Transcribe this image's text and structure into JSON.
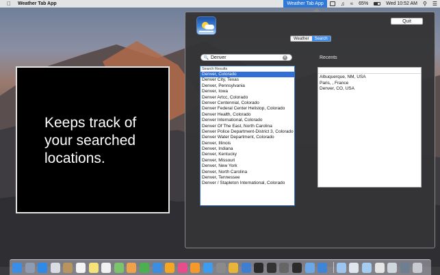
{
  "menubar": {
    "apple_icon": "apple-icon",
    "app_name": "Weather Tab App",
    "status_app": "Weather Tab App",
    "battery": "65%",
    "clock": "Wed 10:52 AM",
    "status_icons": [
      "display-icon",
      "volume-icon",
      "wifi-icon",
      "battery-icon",
      "spotlight-icon",
      "notification-center-icon"
    ]
  },
  "caption": {
    "text": "Keeps track of your searched locations."
  },
  "popover": {
    "quit_label": "Quit",
    "tabs": [
      {
        "label": "Weather",
        "selected": false
      },
      {
        "label": "Search",
        "selected": true
      }
    ],
    "search": {
      "value": "Denver",
      "placeholder": ""
    },
    "results": {
      "header": "Search Results",
      "items": [
        "Denver, Colorado",
        "Denver City, Texas",
        "Denver, Pennsylvania",
        "Denver, Iowa",
        "Denver Artcc, Colorado",
        "Denver Centennial, Colorado",
        "Denver Federal Center Helistop, Colorado",
        "Denver Health, Colorado",
        "Denver International, Colorado",
        "Denver Of The East, North Carolina",
        "Denver Police Department-District 3, Colorado",
        "Denver Water Department, Colorado",
        "Denver, Illinois",
        "Denver, Indiana",
        "Denver, Kentucky",
        "Denver, Missouri",
        "Denver, New York",
        "Denver, North Carolina",
        "Denver, Tennessee",
        "Denver / Stapleton International, Colorado"
      ],
      "selected_index": 0
    },
    "recents": {
      "title": "Recents",
      "items": [
        "Albuquerque, NM, USA",
        "Paris, , France",
        "Denver, CO, USA"
      ]
    }
  },
  "dock": {
    "icons": [
      {
        "name": "finder-icon",
        "color": "#3a8ee6"
      },
      {
        "name": "launchpad-icon",
        "color": "#8f9bb0"
      },
      {
        "name": "safari-icon",
        "color": "#2d8ae8"
      },
      {
        "name": "mail-icon",
        "color": "#d9dde3"
      },
      {
        "name": "contacts-icon",
        "color": "#b8945f"
      },
      {
        "name": "calendar-icon",
        "color": "#f4f4f4"
      },
      {
        "name": "notes-icon",
        "color": "#f5e27a"
      },
      {
        "name": "reminders-icon",
        "color": "#f2f2f2"
      },
      {
        "name": "maps-icon",
        "color": "#7cc46c"
      },
      {
        "name": "photos-icon",
        "color": "#f0a24a"
      },
      {
        "name": "numbers-icon",
        "color": "#4caf50"
      },
      {
        "name": "keynote-icon",
        "color": "#3c8ee0"
      },
      {
        "name": "pages-icon",
        "color": "#f5a623"
      },
      {
        "name": "itunes-icon",
        "color": "#e84c8a"
      },
      {
        "name": "ibooks-icon",
        "color": "#f39a2b"
      },
      {
        "name": "app-store-icon",
        "color": "#3b9cf0"
      },
      {
        "name": "system-preferences-icon",
        "color": "#8b8b8b"
      },
      {
        "name": "chrome-icon",
        "color": "#e9b43a"
      },
      {
        "name": "xcode-icon",
        "color": "#3f7fd1"
      },
      {
        "name": "terminal-icon",
        "color": "#2a2a2a"
      },
      {
        "name": "activity-monitor-icon",
        "color": "#333333"
      },
      {
        "name": "instruments-icon",
        "color": "#666666"
      },
      {
        "name": "console-icon",
        "color": "#2b2b2b"
      },
      {
        "name": "preview-icon",
        "color": "#6aa8e8"
      },
      {
        "name": "weather-tab-app-icon",
        "color": "#3f84d6"
      },
      {
        "name": "folder-icon",
        "color": "#9cc6f0"
      },
      {
        "name": "documents-icon",
        "color": "#dfe6ee"
      },
      {
        "name": "downloads-icon",
        "color": "#a6cdf2"
      },
      {
        "name": "screenshot-stack-icon",
        "color": "#e5e5e5"
      },
      {
        "name": "file-stack-icon",
        "color": "#d0d6dd"
      },
      {
        "name": "image-stack-icon",
        "color": "#6f7f92"
      },
      {
        "name": "trash-icon",
        "color": "#c8ccd2"
      }
    ]
  }
}
